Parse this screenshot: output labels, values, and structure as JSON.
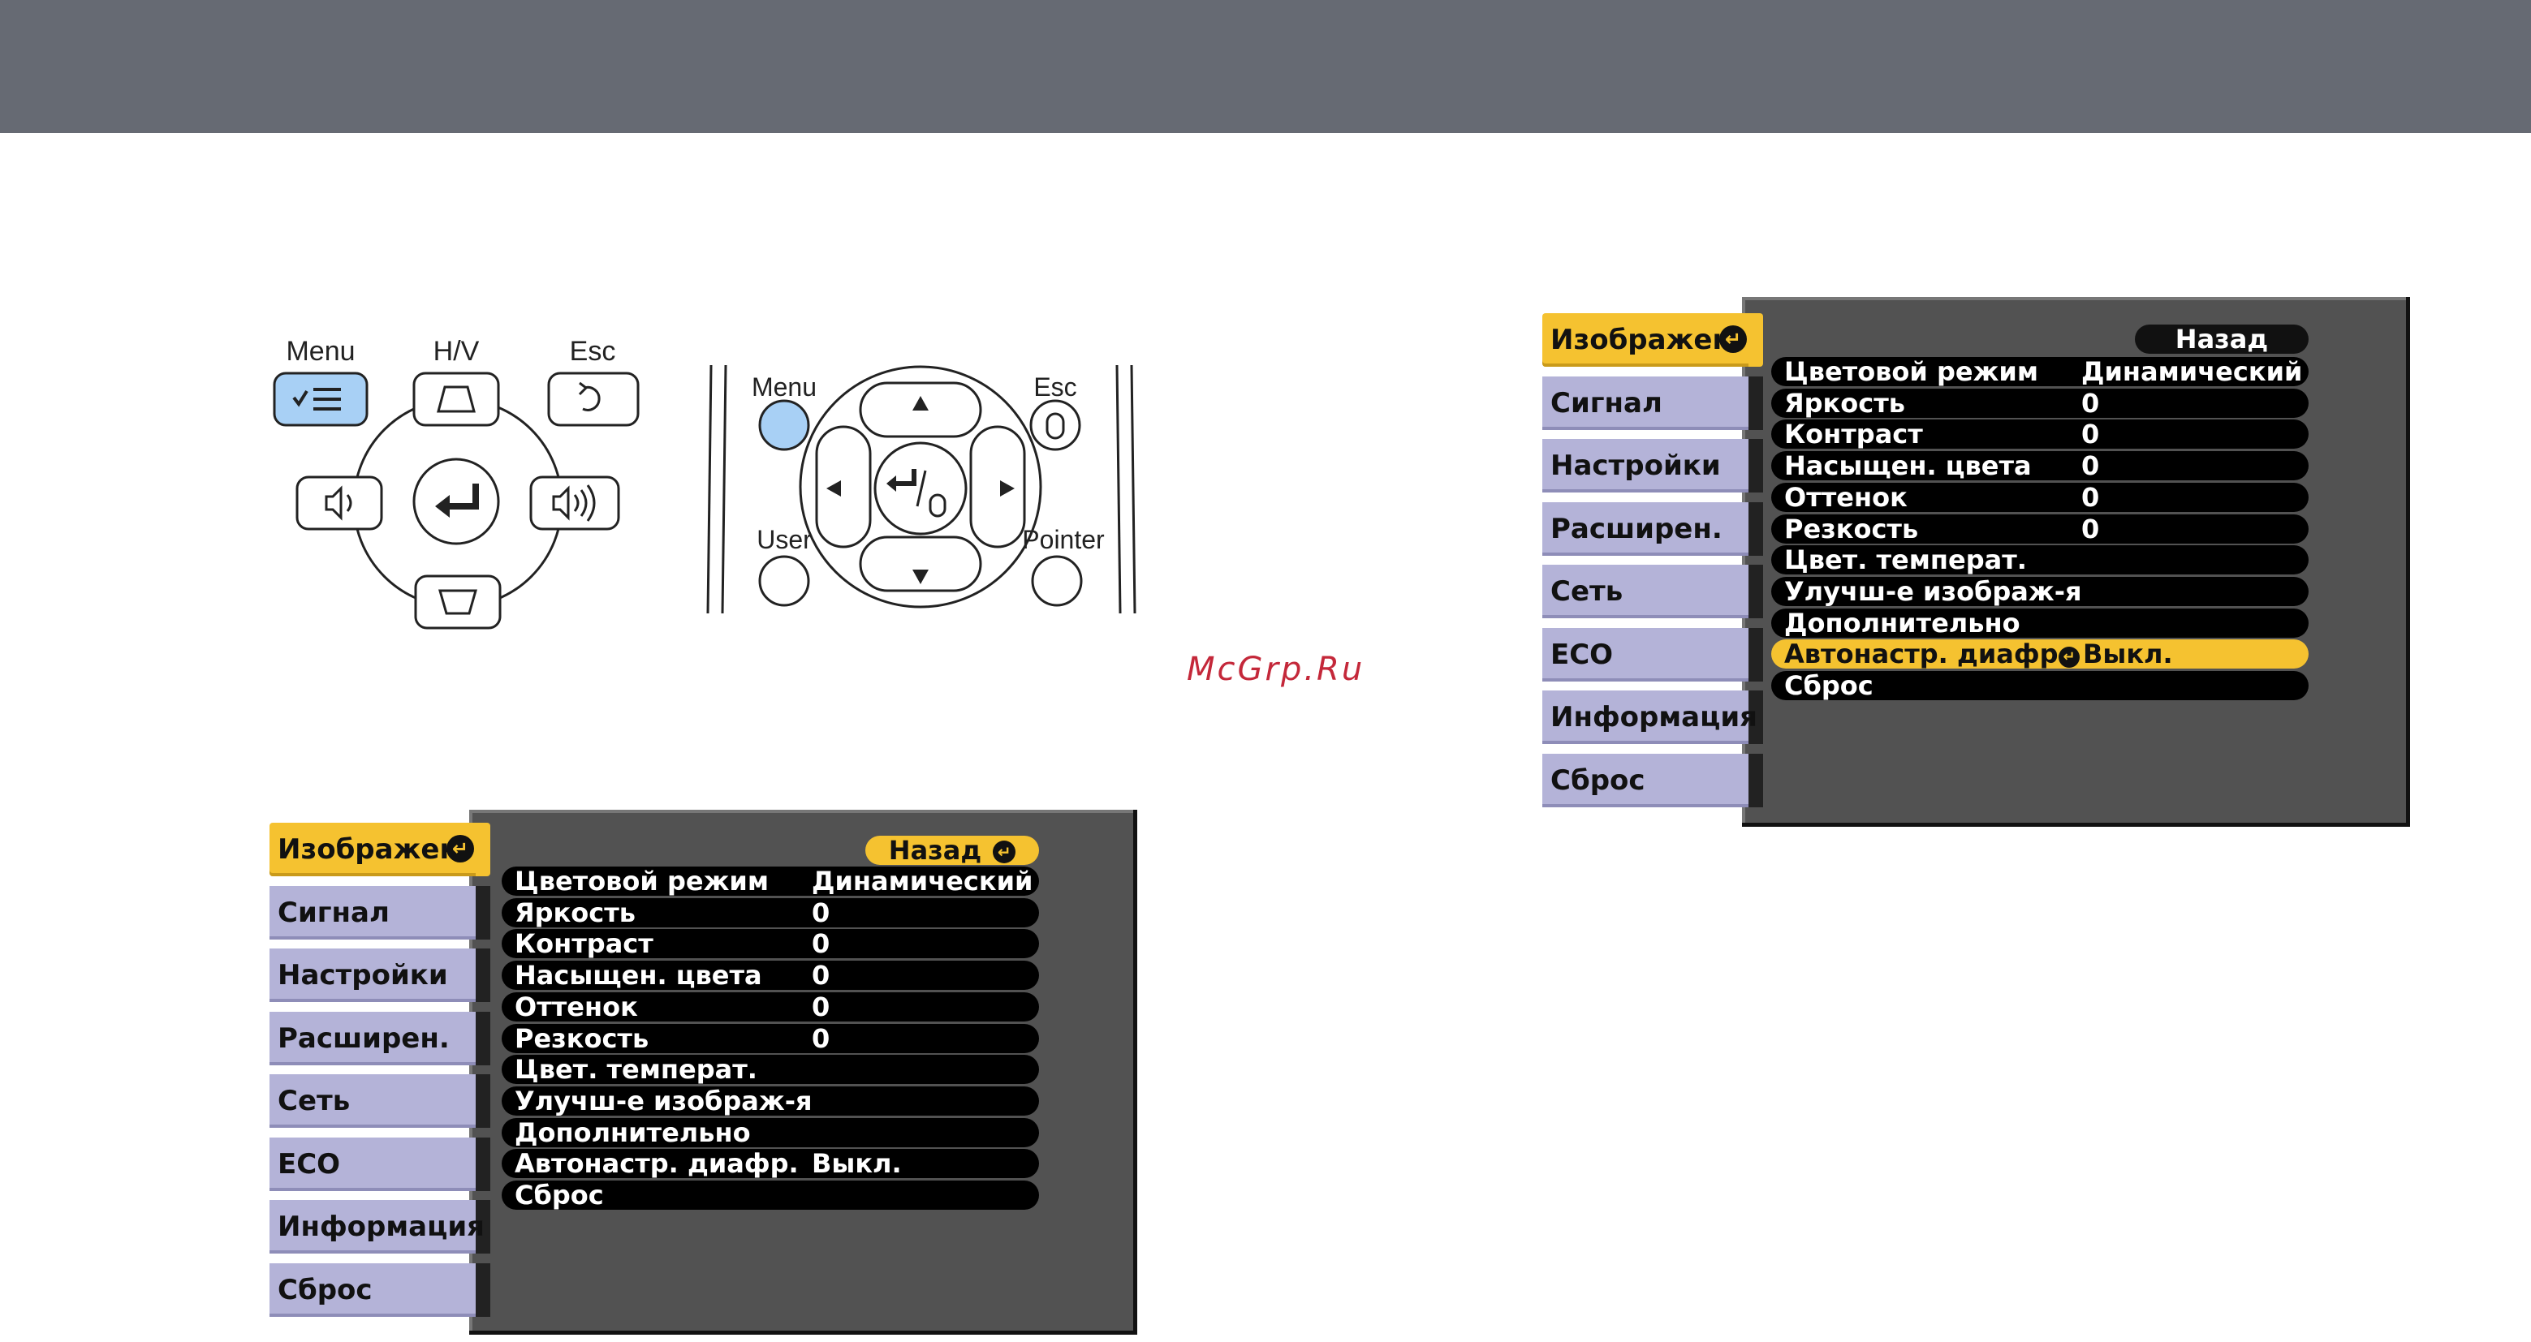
{
  "control_panel": {
    "menu_label": "Menu",
    "hv_label": "H/V",
    "esc_label": "Esc"
  },
  "remote": {
    "menu_label": "Menu",
    "esc_label": "Esc",
    "user_label": "User",
    "pointer_label": "Pointer"
  },
  "watermark": "McGrp.Ru",
  "menu_tabs": [
    "Изображен.",
    "Сигнал",
    "Настройки",
    "Расширен.",
    "Сеть",
    "ECO",
    "Информация",
    "Сброс"
  ],
  "menu_back": "Назад",
  "menu_rows": [
    {
      "label": "Цветовой режим",
      "value": "Динамический"
    },
    {
      "label": "Яркость",
      "value": "0"
    },
    {
      "label": "Контраст",
      "value": "0"
    },
    {
      "label": "Насыщен. цвета",
      "value": "0"
    },
    {
      "label": "Оттенок",
      "value": "0"
    },
    {
      "label": "Резкость",
      "value": "0"
    },
    {
      "label": "Цвет. температ.",
      "value": ""
    },
    {
      "label": "Улучш-е изображ-я",
      "value": ""
    },
    {
      "label": "Дополнительно",
      "value": ""
    },
    {
      "label": "Автонастр. диафр.",
      "value": "Выкл."
    },
    {
      "label": "Сброс",
      "value": ""
    }
  ],
  "colors": {
    "highlight": "#f5c230",
    "tab": "#b4b3d8",
    "panel": "#525252",
    "menu_button": "#a8d0f5",
    "topbar": "#666a73",
    "watermark": "#c4283a"
  }
}
